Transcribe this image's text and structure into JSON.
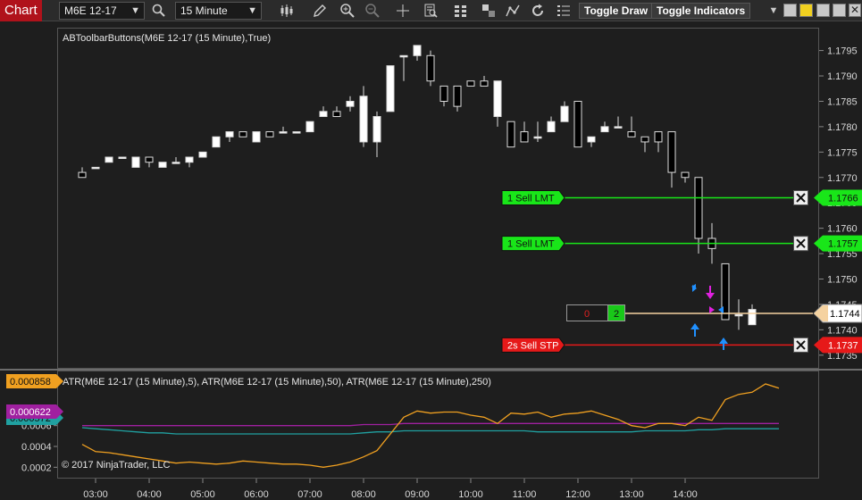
{
  "toolbar": {
    "chart_tab": "Chart",
    "instrument": "M6E 12-17",
    "interval": "15 Minute",
    "toggle_draw": "Toggle Draw",
    "toggle_indicators": "Toggle Indicators",
    "icons": [
      "search-icon",
      "bar-type-icon",
      "pencil-icon",
      "zoom-in-icon",
      "zoom-out-icon",
      "crosshair-icon",
      "data-box-icon",
      "strategies-icon",
      "properties-icon",
      "line-icon",
      "refresh-icon",
      "indicators-list-icon"
    ]
  },
  "price_panel": {
    "indicator_label": "ABToolbarButtons(M6E 12-17 (15 Minute),True)",
    "y_ticks": [
      "1.1795",
      "1.1790",
      "1.1785",
      "1.1780",
      "1.1775",
      "1.1770",
      "1.1765",
      "1.1760",
      "1.1755",
      "1.1750",
      "1.1745",
      "1.1740",
      "1.1735"
    ],
    "last_price": "1.1744",
    "position": {
      "pnl": "0",
      "qty": "2"
    }
  },
  "orders": [
    {
      "label": "1  Sell LMT",
      "price": "1.1766",
      "color": "#19e619"
    },
    {
      "label": "1  Sell LMT",
      "price": "1.1757",
      "color": "#19e619"
    },
    {
      "label": "2s  Sell STP",
      "price": "1.1737",
      "color": "#e61919"
    }
  ],
  "atr_panel": {
    "label": "ATR(M6E 12-17 (15 Minute),5), ATR(M6E 12-17 (15 Minute),50), ATR(M6E 12-17 (15 Minute),250)",
    "y_ticks": [
      "0.0006",
      "0.0004",
      "0.0002"
    ],
    "values": {
      "atr5": "0.000858",
      "atr50": "0.000622",
      "atr250": "0.000572"
    },
    "copyright": "© 2017 NinjaTrader, LLC"
  },
  "x_axis": [
    "03:00",
    "04:00",
    "05:00",
    "06:00",
    "07:00",
    "08:00",
    "09:00",
    "10:00",
    "11:00",
    "12:00",
    "13:00",
    "14:00"
  ],
  "colors": {
    "atr5": "#f0a020",
    "atr50": "#a020a0",
    "atr250": "#20a0a0",
    "up_candle": "#ffffff",
    "down_candle": "#000000",
    "position_line": "#f5d2a0"
  },
  "chart_data": {
    "type": "candlestick",
    "x_label_interval": "15 Minute",
    "candles": [
      {
        "o": 1.1771,
        "h": 1.1772,
        "l": 1.177,
        "c": 1.177
      },
      {
        "o": 1.1772,
        "h": 1.1772,
        "l": 1.1772,
        "c": 1.1772
      },
      {
        "o": 1.1773,
        "h": 1.1774,
        "l": 1.1773,
        "c": 1.1774
      },
      {
        "o": 1.1774,
        "h": 1.1774,
        "l": 1.1774,
        "c": 1.1774
      },
      {
        "o": 1.1772,
        "h": 1.1774,
        "l": 1.1772,
        "c": 1.1774
      },
      {
        "o": 1.1774,
        "h": 1.1774,
        "l": 1.1772,
        "c": 1.1773
      },
      {
        "o": 1.1772,
        "h": 1.1773,
        "l": 1.1772,
        "c": 1.1773
      },
      {
        "o": 1.1773,
        "h": 1.1774,
        "l": 1.1773,
        "c": 1.1773
      },
      {
        "o": 1.1773,
        "h": 1.1774,
        "l": 1.1772,
        "c": 1.1774
      },
      {
        "o": 1.1774,
        "h": 1.1775,
        "l": 1.1774,
        "c": 1.1775
      },
      {
        "o": 1.1776,
        "h": 1.1778,
        "l": 1.1776,
        "c": 1.1778
      },
      {
        "o": 1.1778,
        "h": 1.1779,
        "l": 1.1777,
        "c": 1.1779
      },
      {
        "o": 1.1779,
        "h": 1.1779,
        "l": 1.1778,
        "c": 1.1778
      },
      {
        "o": 1.1777,
        "h": 1.1779,
        "l": 1.1777,
        "c": 1.1779
      },
      {
        "o": 1.1779,
        "h": 1.1779,
        "l": 1.1778,
        "c": 1.1778
      },
      {
        "o": 1.1779,
        "h": 1.178,
        "l": 1.1779,
        "c": 1.1779
      },
      {
        "o": 1.1779,
        "h": 1.1779,
        "l": 1.1779,
        "c": 1.1779
      },
      {
        "o": 1.1779,
        "h": 1.1781,
        "l": 1.1779,
        "c": 1.1781
      },
      {
        "o": 1.1782,
        "h": 1.1784,
        "l": 1.1782,
        "c": 1.1783
      },
      {
        "o": 1.1783,
        "h": 1.1784,
        "l": 1.1782,
        "c": 1.1782
      },
      {
        "o": 1.1784,
        "h": 1.1786,
        "l": 1.1783,
        "c": 1.1785
      },
      {
        "o": 1.1777,
        "h": 1.1788,
        "l": 1.1776,
        "c": 1.1786
      },
      {
        "o": 1.1777,
        "h": 1.1783,
        "l": 1.1774,
        "c": 1.1782
      },
      {
        "o": 1.1783,
        "h": 1.1792,
        "l": 1.1783,
        "c": 1.1792
      },
      {
        "o": 1.1794,
        "h": 1.1794,
        "l": 1.1789,
        "c": 1.1794
      },
      {
        "o": 1.1794,
        "h": 1.1796,
        "l": 1.1793,
        "c": 1.1796
      },
      {
        "o": 1.1794,
        "h": 1.1795,
        "l": 1.1788,
        "c": 1.1789
      },
      {
        "o": 1.1788,
        "h": 1.1788,
        "l": 1.1784,
        "c": 1.1785
      },
      {
        "o": 1.1788,
        "h": 1.1788,
        "l": 1.1783,
        "c": 1.1784
      },
      {
        "o": 1.1789,
        "h": 1.1789,
        "l": 1.1788,
        "c": 1.1788
      },
      {
        "o": 1.1789,
        "h": 1.179,
        "l": 1.1788,
        "c": 1.1788
      },
      {
        "o": 1.1782,
        "h": 1.1789,
        "l": 1.178,
        "c": 1.1789
      },
      {
        "o": 1.1781,
        "h": 1.1781,
        "l": 1.1776,
        "c": 1.1776
      },
      {
        "o": 1.1779,
        "h": 1.1781,
        "l": 1.1777,
        "c": 1.1777
      },
      {
        "o": 1.1778,
        "h": 1.1781,
        "l": 1.1777,
        "c": 1.1778
      },
      {
        "o": 1.1779,
        "h": 1.1782,
        "l": 1.1779,
        "c": 1.1781
      },
      {
        "o": 1.1781,
        "h": 1.1785,
        "l": 1.1781,
        "c": 1.1784
      },
      {
        "o": 1.1785,
        "h": 1.1785,
        "l": 1.1776,
        "c": 1.1776
      },
      {
        "o": 1.1777,
        "h": 1.1778,
        "l": 1.1776,
        "c": 1.1778
      },
      {
        "o": 1.1779,
        "h": 1.1781,
        "l": 1.1779,
        "c": 1.178
      },
      {
        "o": 1.178,
        "h": 1.1782,
        "l": 1.178,
        "c": 1.178
      },
      {
        "o": 1.1779,
        "h": 1.1782,
        "l": 1.1778,
        "c": 1.1778
      },
      {
        "o": 1.1778,
        "h": 1.1778,
        "l": 1.1775,
        "c": 1.1777
      },
      {
        "o": 1.1779,
        "h": 1.1779,
        "l": 1.1775,
        "c": 1.1777
      },
      {
        "o": 1.1779,
        "h": 1.1779,
        "l": 1.1768,
        "c": 1.1771
      },
      {
        "o": 1.1771,
        "h": 1.1771,
        "l": 1.1769,
        "c": 1.177
      },
      {
        "o": 1.177,
        "h": 1.177,
        "l": 1.1755,
        "c": 1.1758
      },
      {
        "o": 1.1758,
        "h": 1.1761,
        "l": 1.1753,
        "c": 1.1756
      },
      {
        "o": 1.1753,
        "h": 1.1753,
        "l": 1.1742,
        "c": 1.1742
      },
      {
        "o": 1.1743,
        "h": 1.1746,
        "l": 1.174,
        "c": 1.1743
      },
      {
        "o": 1.1741,
        "h": 1.1745,
        "l": 1.1741,
        "c": 1.1744
      }
    ],
    "atr5": [
      0.00042,
      0.00035,
      0.00034,
      0.00032,
      0.0003,
      0.00028,
      0.00026,
      0.00024,
      0.00025,
      0.00024,
      0.00023,
      0.00024,
      0.00026,
      0.00025,
      0.00024,
      0.00023,
      0.00023,
      0.00022,
      0.0002,
      0.00022,
      0.00025,
      0.0003,
      0.00036,
      0.00052,
      0.00068,
      0.00074,
      0.00072,
      0.00073,
      0.00073,
      0.0007,
      0.00068,
      0.00062,
      0.00072,
      0.00071,
      0.00073,
      0.00068,
      0.00071,
      0.00072,
      0.00074,
      0.0007,
      0.00066,
      0.0006,
      0.00058,
      0.00062,
      0.00062,
      0.0006,
      0.00068,
      0.00065,
      0.00085,
      0.0009,
      0.00092,
      0.001,
      0.00096
    ],
    "atr50": [
      0.0006,
      0.0006,
      0.0006,
      0.0006,
      0.0006,
      0.0006,
      0.0006,
      0.0006,
      0.0006,
      0.0006,
      0.0006,
      0.0006,
      0.0006,
      0.0006,
      0.0006,
      0.0006,
      0.0006,
      0.0006,
      0.0006,
      0.0006,
      0.0006,
      0.00061,
      0.00061,
      0.00061,
      0.00062,
      0.00062,
      0.00062,
      0.00062,
      0.00062,
      0.00062,
      0.00062,
      0.00062,
      0.00062,
      0.00062,
      0.00062,
      0.00062,
      0.00062,
      0.00062,
      0.00062,
      0.00062,
      0.00062,
      0.00062,
      0.00062,
      0.00062,
      0.00062,
      0.00062,
      0.00062,
      0.00062,
      0.00062,
      0.00062,
      0.00062,
      0.00062,
      0.00062
    ],
    "atr250": [
      0.00058,
      0.00057,
      0.00056,
      0.00055,
      0.00054,
      0.00053,
      0.00053,
      0.00052,
      0.00052,
      0.00052,
      0.00052,
      0.00052,
      0.00052,
      0.00052,
      0.00052,
      0.00052,
      0.00052,
      0.00052,
      0.00052,
      0.00052,
      0.00052,
      0.00053,
      0.00054,
      0.00054,
      0.00055,
      0.00055,
      0.00055,
      0.00055,
      0.00055,
      0.00055,
      0.00055,
      0.00055,
      0.00055,
      0.00055,
      0.00054,
      0.00054,
      0.00054,
      0.00054,
      0.00054,
      0.00054,
      0.00054,
      0.00054,
      0.00055,
      0.00055,
      0.00055,
      0.00055,
      0.00056,
      0.00056,
      0.00057,
      0.00057,
      0.00057,
      0.00057,
      0.00057
    ],
    "price_range": [
      1.17325,
      1.17995
    ],
    "atr_range": [
      0.0001,
      0.00112
    ]
  }
}
